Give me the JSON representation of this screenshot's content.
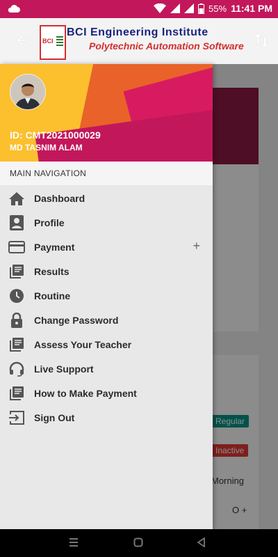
{
  "status_bar": {
    "battery_pct": "55%",
    "time": "11:41 PM"
  },
  "header": {
    "logo_text": "BCI",
    "title_line1": "BCI Engineering Institute",
    "title_line2": "Polytechnic Automation Software"
  },
  "profile": {
    "id": "ID: CMT2021000029",
    "name": "MD TASNIM ALAM"
  },
  "nav": {
    "section_label": "MAIN NAVIGATION",
    "items": [
      {
        "label": "Dashboard",
        "icon": "home-icon"
      },
      {
        "label": "Profile",
        "icon": "person-icon"
      },
      {
        "label": "Payment",
        "icon": "card-icon",
        "expand": "+"
      },
      {
        "label": "Results",
        "icon": "library-icon"
      },
      {
        "label": "Routine",
        "icon": "clock-icon"
      },
      {
        "label": "Change Password",
        "icon": "lock-icon"
      },
      {
        "label": "Assess Your Teacher",
        "icon": "library-icon"
      },
      {
        "label": "Live Support",
        "icon": "headset-icon"
      },
      {
        "label": "How to Make Payment",
        "icon": "library-icon"
      },
      {
        "label": "Sign Out",
        "icon": "exit-icon"
      }
    ]
  },
  "background_page": {
    "badge_regular": "Regular",
    "badge_inactive": "Inactive",
    "shift": "Morning",
    "blood_group": "O +"
  },
  "colors": {
    "status_bar": "#c2185b",
    "regular": "#009688",
    "inactive": "#e53935"
  }
}
